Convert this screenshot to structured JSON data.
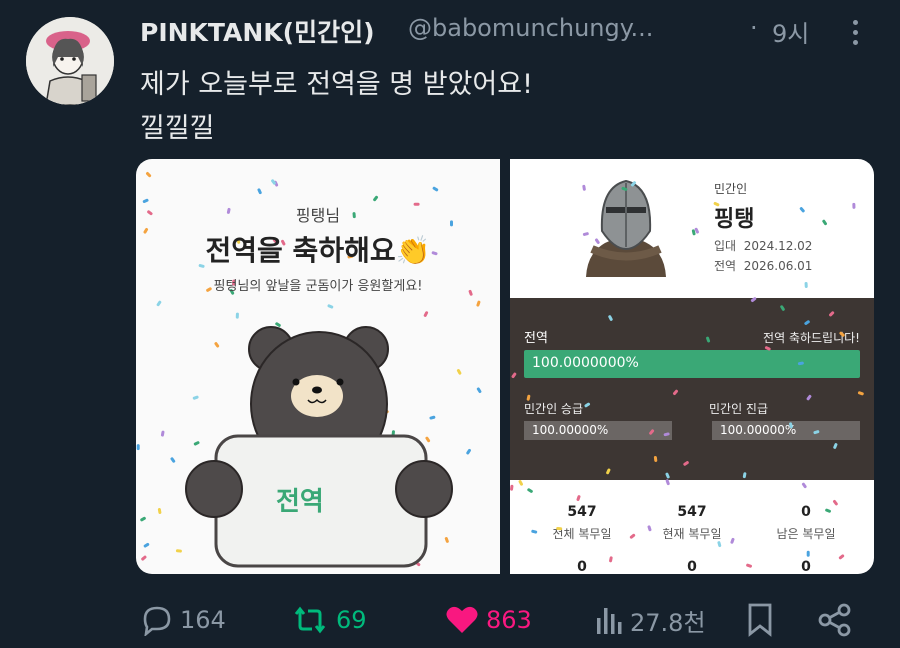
{
  "tweet": {
    "display_name": "PINKTANK(민간인)",
    "handle": "@babomunchungy...",
    "dot": "·",
    "time": "9시",
    "text_line1": "제가 오늘부로 전역을 명 받았어요!",
    "text_line2": "낄낄낄"
  },
  "card_left": {
    "name": "핑탱님",
    "title": "전역을 축하해요👏",
    "subtitle": "핑텅님의 앞날을 군돔이가 응원할게요!",
    "sign_text": "전역"
  },
  "card_right": {
    "label": "민간인",
    "name": "핑탱",
    "enlist_label": "입대",
    "enlist_date": "2024.12.02",
    "discharge_label": "전역",
    "discharge_date": "2026.06.01",
    "panel_title": "전역",
    "panel_congrats": "전역 축하드립니다!",
    "main_progress_text": "100.0000000%",
    "main_progress": 100,
    "promo_label": "민간인 승급",
    "promo_value": "100.00000%",
    "promo_progress": 100,
    "rank_label": "민간인 진급",
    "rank_value": "100.00000%",
    "rank_progress": 100,
    "stats": [
      {
        "value": "547",
        "label": "전체 복무일",
        "sub": "0"
      },
      {
        "value": "547",
        "label": "현재 복무일",
        "sub": "0"
      },
      {
        "value": "0",
        "label": "남은 복무일",
        "sub": "0"
      }
    ]
  },
  "actions": {
    "replies": "164",
    "retweets": "69",
    "likes": "863",
    "views": "27.8천"
  },
  "colors": {
    "background": "#15202b",
    "text": "#e7e9ea",
    "muted": "#8b98a5",
    "retweet": "#00ba7c",
    "like": "#f91880",
    "progress": "#3aa876",
    "panel": "#3d3633"
  }
}
